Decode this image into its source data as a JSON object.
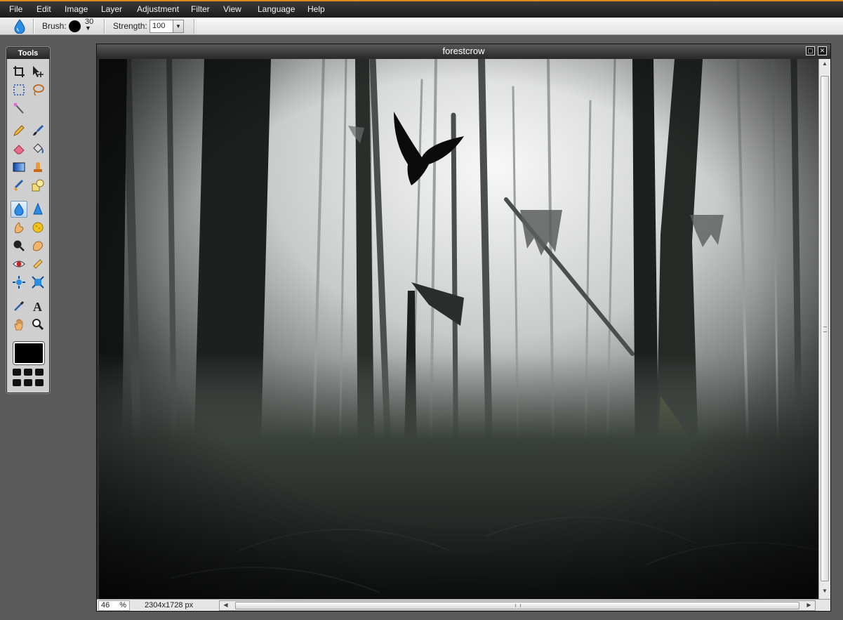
{
  "menu": [
    "File",
    "Edit",
    "Image",
    "Layer",
    "Adjustment",
    "Filter",
    "View",
    "Language",
    "Help"
  ],
  "options": {
    "tool_icon": "drop-icon",
    "brush_label": "Brush:",
    "brush_size": "30",
    "strength_label": "Strength:",
    "strength_value": "100"
  },
  "tools": {
    "title": "Tools",
    "items": [
      {
        "name": "crop-tool"
      },
      {
        "name": "move-tool"
      },
      {
        "name": "marquee-tool"
      },
      {
        "name": "lasso-tool"
      },
      {
        "name": "magic-wand-tool"
      },
      {
        "name": "pencil-tool"
      },
      {
        "name": "brush-tool"
      },
      {
        "name": "eraser-tool"
      },
      {
        "name": "paint-bucket-tool"
      },
      {
        "name": "gradient-tool"
      },
      {
        "name": "clone-stamp-tool"
      },
      {
        "name": "color-replace-tool"
      },
      {
        "name": "shape-tool"
      },
      {
        "name": "blur-tool"
      },
      {
        "name": "sharpen-tool"
      },
      {
        "name": "smudge-tool"
      },
      {
        "name": "sponge-tool"
      },
      {
        "name": "dodge-tool"
      },
      {
        "name": "burn-tool"
      },
      {
        "name": "red-eye-tool"
      },
      {
        "name": "spot-heal-tool"
      },
      {
        "name": "bloat-tool"
      },
      {
        "name": "pinch-tool"
      },
      {
        "name": "color-picker-tool"
      },
      {
        "name": "type-tool"
      },
      {
        "name": "hand-tool"
      },
      {
        "name": "zoom-tool"
      }
    ],
    "active": "blur-tool",
    "foreground_color": "#000000"
  },
  "window": {
    "title": "forestcrow",
    "zoom": "46",
    "zoom_unit": "%",
    "image_size": "2304x1728 px"
  },
  "colors": {
    "accent": "#e08a1e",
    "menubar": "#262626"
  }
}
